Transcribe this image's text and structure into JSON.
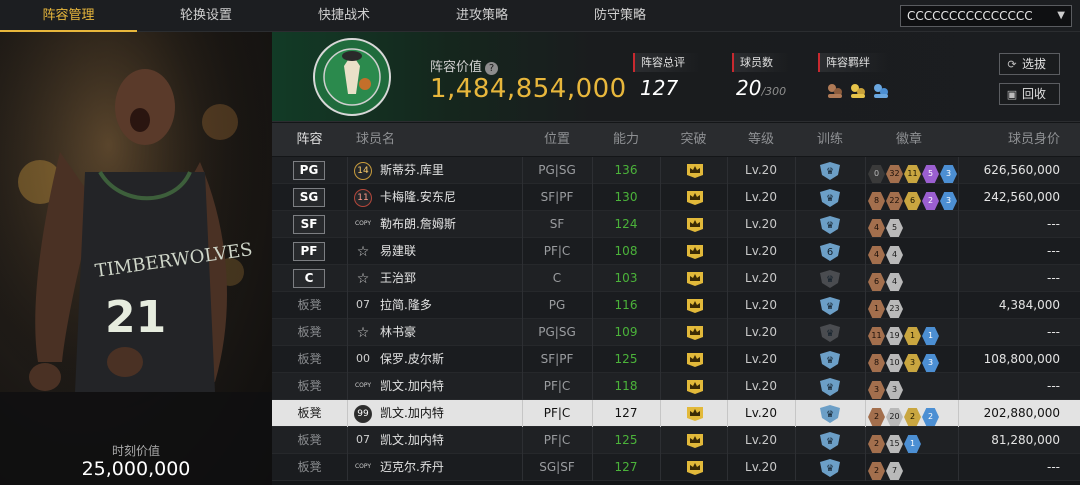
{
  "nav": {
    "tabs": [
      {
        "label": "阵容管理",
        "active": true
      },
      {
        "label": "轮换设置",
        "active": false
      },
      {
        "label": "快捷战术",
        "active": false
      },
      {
        "label": "进攻策略",
        "active": false
      },
      {
        "label": "防守策略",
        "active": false
      }
    ],
    "account": "CCCCCCCCCCCCCCC",
    "account_caret_icon": "chevron-down-icon"
  },
  "portrait": {
    "moment_label": "时刻价值",
    "moment_value": "25,000,000"
  },
  "header": {
    "team_logo_icon": "celtics-logo",
    "value_label": "阵容价值",
    "value_help_icon": "question-icon",
    "value": "1,484,854,000",
    "overall_label": "阵容总评",
    "overall_value": "127",
    "players_label": "球员数",
    "players_value": "20",
    "players_max": "/300",
    "bonds_label": "阵容羁绊",
    "bond_icons": [
      "bond-bronze-icon",
      "bond-gold-icon",
      "bond-blue-icon"
    ],
    "select_button": "选拔",
    "recycle_button": "回收"
  },
  "table": {
    "headers": {
      "lineup": "阵容",
      "name": "球员名",
      "position": "位置",
      "ability": "能力",
      "breakthrough": "突破",
      "level": "等级",
      "training": "训练",
      "badges": "徽章",
      "price": "球员身价"
    },
    "rows": [
      {
        "slot": "PG",
        "starter": true,
        "jersey": "14",
        "jersey_style": "gold",
        "name": "斯蒂芬.库里",
        "position": "PG|SG",
        "ability": "136",
        "level": "Lv.20",
        "train": "active",
        "badges": [
          {
            "t": "dark",
            "v": "0"
          },
          {
            "t": "bronze",
            "v": "32"
          },
          {
            "t": "gold",
            "v": "11"
          },
          {
            "t": "purple",
            "v": "5"
          },
          {
            "t": "blue",
            "v": "3"
          }
        ],
        "price": "626,560,000"
      },
      {
        "slot": "SG",
        "starter": true,
        "jersey": "11",
        "jersey_style": "red",
        "name": "卡梅隆.安东尼",
        "position": "SF|PF",
        "ability": "130",
        "level": "Lv.20",
        "train": "active",
        "badges": [
          {
            "t": "bronze",
            "v": "8"
          },
          {
            "t": "bronze",
            "v": "22"
          },
          {
            "t": "gold",
            "v": "6"
          },
          {
            "t": "purple",
            "v": "2"
          },
          {
            "t": "blue",
            "v": "3"
          }
        ],
        "price": "242,560,000"
      },
      {
        "slot": "SF",
        "starter": true,
        "jersey": "COPY",
        "jersey_style": "copy",
        "name": "勒布朗.詹姆斯",
        "position": "SF",
        "ability": "124",
        "level": "Lv.20",
        "train": "active",
        "badges": [
          {
            "t": "bronze",
            "v": "4"
          },
          {
            "t": "silver",
            "v": "5"
          }
        ],
        "price": "---"
      },
      {
        "slot": "PF",
        "starter": true,
        "jersey": "☆",
        "jersey_style": "star",
        "name": "易建联",
        "position": "PF|C",
        "ability": "108",
        "level": "Lv.20",
        "train": "level6",
        "badges": [
          {
            "t": "bronze",
            "v": "4"
          },
          {
            "t": "silver",
            "v": "4"
          }
        ],
        "price": "---"
      },
      {
        "slot": "C",
        "starter": true,
        "jersey": "☆",
        "jersey_style": "star",
        "name": "王治郅",
        "position": "C",
        "ability": "103",
        "level": "Lv.20",
        "train": "inactive",
        "badges": [
          {
            "t": "bronze",
            "v": "6"
          },
          {
            "t": "silver",
            "v": "4"
          }
        ],
        "price": "---"
      },
      {
        "slot": "板凳",
        "starter": false,
        "jersey": "07",
        "jersey_style": "plain",
        "name": "拉简.隆多",
        "position": "PG",
        "ability": "116",
        "level": "Lv.20",
        "train": "active",
        "badges": [
          {
            "t": "bronze",
            "v": "1"
          },
          {
            "t": "silver",
            "v": "23"
          }
        ],
        "price": "4,384,000"
      },
      {
        "slot": "板凳",
        "starter": false,
        "jersey": "☆",
        "jersey_style": "star",
        "name": "林书豪",
        "position": "PG|SG",
        "ability": "109",
        "level": "Lv.20",
        "train": "inactive",
        "badges": [
          {
            "t": "bronze",
            "v": "11"
          },
          {
            "t": "silver",
            "v": "19"
          },
          {
            "t": "gold",
            "v": "1"
          },
          {
            "t": "blue",
            "v": "1"
          }
        ],
        "price": "---"
      },
      {
        "slot": "板凳",
        "starter": false,
        "jersey": "00",
        "jersey_style": "plain",
        "name": "保罗.皮尔斯",
        "position": "SF|PF",
        "ability": "125",
        "level": "Lv.20",
        "train": "active",
        "badges": [
          {
            "t": "bronze",
            "v": "8"
          },
          {
            "t": "silver",
            "v": "10"
          },
          {
            "t": "gold",
            "v": "3"
          },
          {
            "t": "blue",
            "v": "3"
          }
        ],
        "price": "108,800,000"
      },
      {
        "slot": "板凳",
        "starter": false,
        "jersey": "COPY",
        "jersey_style": "copy",
        "name": "凯文.加内特",
        "position": "PF|C",
        "ability": "118",
        "level": "Lv.20",
        "train": "active",
        "badges": [
          {
            "t": "bronze",
            "v": "3"
          },
          {
            "t": "silver",
            "v": "3"
          }
        ],
        "price": "---"
      },
      {
        "slot": "板凳",
        "starter": false,
        "selected": true,
        "jersey": "99",
        "jersey_style": "sel",
        "name": "凯文.加内特",
        "position": "PF|C",
        "ability": "127",
        "level": "Lv.20",
        "train": "active",
        "badges": [
          {
            "t": "bronze",
            "v": "2"
          },
          {
            "t": "silver",
            "v": "20"
          },
          {
            "t": "gold",
            "v": "2"
          },
          {
            "t": "blue",
            "v": "2"
          }
        ],
        "price": "202,880,000"
      },
      {
        "slot": "板凳",
        "starter": false,
        "jersey": "07",
        "jersey_style": "plain",
        "name": "凯文.加内特",
        "position": "PF|C",
        "ability": "125",
        "level": "Lv.20",
        "train": "active",
        "badges": [
          {
            "t": "bronze",
            "v": "2"
          },
          {
            "t": "silver",
            "v": "15"
          },
          {
            "t": "blue",
            "v": "1"
          }
        ],
        "price": "81,280,000"
      },
      {
        "slot": "板凳",
        "starter": false,
        "jersey": "COPY",
        "jersey_style": "copy",
        "name": "迈克尔.乔丹",
        "position": "SG|SF",
        "ability": "127",
        "level": "Lv.20",
        "train": "active",
        "badges": [
          {
            "t": "bronze",
            "v": "2"
          },
          {
            "t": "silver",
            "v": "7"
          }
        ],
        "price": "---"
      }
    ]
  },
  "colors": {
    "accent": "#e8b73c",
    "ability_green": "#4bb33a",
    "stat_marker": "#c8292f",
    "crown_gold": "#e2b93a",
    "train_blue": "#6c9fc7"
  }
}
